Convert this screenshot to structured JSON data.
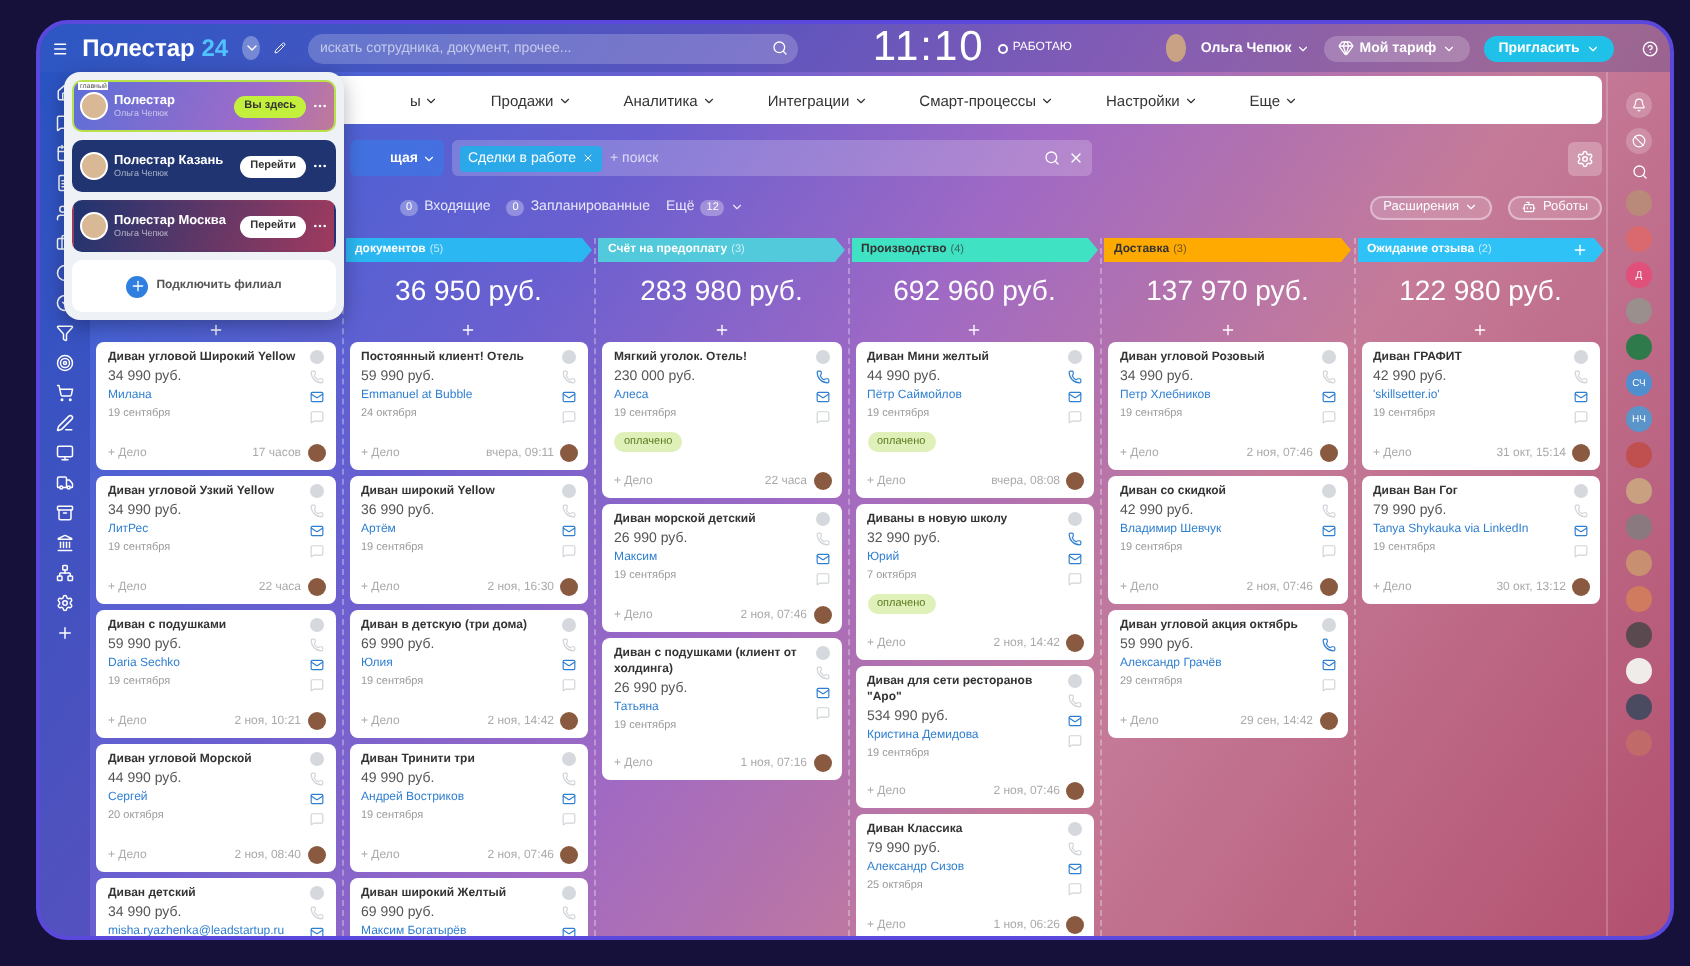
{
  "top_bar": {
    "logo": "Полестар",
    "logo_suffix": "24",
    "search": {
      "placeholder": "искать сотрудника, документ, прочее..."
    },
    "time": "11:10",
    "status": "РАБОТАЮ",
    "user": "Ольга Чепюк",
    "tariff_button": "Мой тариф",
    "invite_button": "Пригласить"
  },
  "nav": [
    "ы",
    "Продажи",
    "Аналитика",
    "Интеграции",
    "Смарт-процессы",
    "Настройки",
    "Еще"
  ],
  "filter": {
    "preset": "щая",
    "tag": "Сделки в работе",
    "placeholder": "+ поиск"
  },
  "counters": [
    {
      "count": "0",
      "label": "Входящие"
    },
    {
      "count": "0",
      "label": "Запланированные"
    }
  ],
  "more": {
    "label": "Ещё",
    "count": "12"
  },
  "toolbar_buttons": [
    "Расширения",
    "Роботы"
  ],
  "branches": {
    "items": [
      {
        "name": "Полестар",
        "owner": "Ольга Чепюк",
        "action": "Вы здесь",
        "selected": true,
        "main_label": "главный"
      },
      {
        "name": "Полестар Казань",
        "owner": "Ольга Чепюк",
        "action": "Перейти",
        "selected": false
      },
      {
        "name": "Полестар Москва",
        "owner": "Ольга Чепюк",
        "action": "Перейти",
        "selected": false
      }
    ],
    "add": "Подключить филиал"
  },
  "columns": [
    {
      "cards": [
        {
          "title": "Диван угловой Широкий Yellow",
          "price": "34 990 руб.",
          "contact": "Милана",
          "date": "19 сентября",
          "action": "+ Дело",
          "time": "17 часов",
          "phone_active": false
        },
        {
          "title": "Диван угловой Узкий Yellow",
          "price": "34 990 руб.",
          "contact": "ЛитРес",
          "date": "19 сентября",
          "action": "+ Дело",
          "time": "22 часа",
          "phone_active": false
        },
        {
          "title": "Диван с подушками",
          "price": "59 990 руб.",
          "contact": "Daria Sechko",
          "date": "19 сентября",
          "action": "+ Дело",
          "time": "2 ноя, 10:21",
          "phone_active": false
        },
        {
          "title": "Диван угловой Морской",
          "price": "44 990 руб.",
          "contact": "Сергей",
          "date": "20 октября",
          "action": "+ Дело",
          "time": "2 ноя, 08:40",
          "phone_active": false
        },
        {
          "title": "Диван детский",
          "price": "34 990 руб.",
          "contact": "misha.ryazhenka@leadstartup.ru",
          "phone_active": false
        }
      ]
    },
    {
      "title": "документов",
      "count": "(5)",
      "color": "#2bb8f2",
      "sum": "36 950 руб.",
      "cards": [
        {
          "title": "Постоянный клиент! Отель",
          "price": "59 990 руб.",
          "contact": "Emmanuel at Bubble",
          "date": "24 октября",
          "action": "+ Дело",
          "time": "вчера, 09:11",
          "phone_active": false
        },
        {
          "title": "Диван широкий Yellow",
          "price": "36 990 руб.",
          "contact": "Артём",
          "date": "19 сентября",
          "action": "+ Дело",
          "time": "2 ноя, 16:30",
          "phone_active": false
        },
        {
          "title": "Диван в детскую (три дома)",
          "price": "69 990 руб.",
          "contact": "Юлия",
          "date": "19 сентября",
          "action": "+ Дело",
          "time": "2 ноя, 14:42",
          "phone_active": false
        },
        {
          "title": "Диван Тринити три",
          "price": "49 990 руб.",
          "contact": "Андрей Востриков",
          "date": "19 сентября",
          "action": "+ Дело",
          "time": "2 ноя, 07:46",
          "phone_active": false
        },
        {
          "title": "Диван широкий Желтый",
          "price": "69 990 руб.",
          "contact": "Максим Богатырёв",
          "phone_active": false
        }
      ]
    },
    {
      "title": "Счёт на предоплату",
      "count": "(3)",
      "color": "#52cadb",
      "sum": "283 980 руб.",
      "cards": [
        {
          "title": "Мягкий уголок. Отель!",
          "price": "230 000 руб.",
          "contact": "Алеса",
          "date": "19 сентября",
          "tag": "оплачено",
          "action": "+ Дело",
          "time": "22 часа",
          "phone_active": true
        },
        {
          "title": "Диван морской детский",
          "price": "26 990 руб.",
          "contact": "Максим",
          "date": "19 сентября",
          "action": "+ Дело",
          "time": "2 ноя, 07:46",
          "phone_active": false
        },
        {
          "title": "Диван с подушками (клиент от холдинга)",
          "price": "26 990 руб.",
          "contact": "Татьяна",
          "date": "19 сентября",
          "action": "+ Дело",
          "time": "1 ноя, 07:16",
          "phone_active": false
        }
      ]
    },
    {
      "title": "Производство",
      "count": "(4)",
      "color": "#3fe2c2",
      "sum": "692 960 руб.",
      "cards": [
        {
          "title": "Диван Мини желтый",
          "price": "44 990 руб.",
          "contact": "Пётр Саймойлов",
          "date": "19 сентября",
          "tag": "оплачено",
          "action": "+ Дело",
          "time": "вчера, 08:08",
          "phone_active": true
        },
        {
          "title": "Диваны в новую школу",
          "price": "32 990 руб.",
          "contact": "Юрий",
          "date": "7 октября",
          "tag": "оплачено",
          "action": "+ Дело",
          "time": "2 ноя, 14:42",
          "phone_active": true
        },
        {
          "title": "Диван для сети ресторанов \"Аро\"",
          "price": "534 990 руб.",
          "contact": "Кристина Демидова",
          "date": "19 сентября",
          "action": "+ Дело",
          "time": "2 ноя, 07:46",
          "phone_active": false
        },
        {
          "title": "Диван Классика",
          "price": "79 990 руб.",
          "contact": "Александр Сизов",
          "date": "25 октября",
          "action": "+ Дело",
          "time": "1 ноя, 06:26",
          "phone_active": false
        }
      ]
    },
    {
      "title": "Доставка",
      "count": "(3)",
      "color": "#ffaa00",
      "sum": "137 970 руб.",
      "cards": [
        {
          "title": "Диван угловой Розовый",
          "price": "34 990 руб.",
          "contact": "Петр Хлебников",
          "date": "19 сентября",
          "action": "+ Дело",
          "time": "2 ноя, 07:46",
          "phone_active": false
        },
        {
          "title": "Диван со скидкой",
          "price": "42 990 руб.",
          "contact": "Владимир Шевчук",
          "date": "19 сентября",
          "action": "+ Дело",
          "time": "2 ноя, 07:46",
          "phone_active": false
        },
        {
          "title": "Диван угловой акция октябрь",
          "price": "59 990 руб.",
          "contact": "Александр Грачёв",
          "date": "29 сентября",
          "action": "+ Дело",
          "time": "29 сен, 14:42",
          "phone_active": true
        }
      ]
    },
    {
      "title": "Ожидание отзыва",
      "count": "(2)",
      "color": "#2fc2f6",
      "sum": "122 980 руб.",
      "cards": [
        {
          "title": "Диван ГРАФИТ",
          "price": "42 990 руб.",
          "contact": "'skillsetter.io'",
          "date": "19 сентября",
          "action": "+ Дело",
          "time": "31 окт, 15:14",
          "phone_active": false
        },
        {
          "title": "Диван Ван Гог",
          "price": "79 990 руб.",
          "contact": "Tanya Shykauka via LinkedIn",
          "date": "19 сентября",
          "action": "+ Дело",
          "time": "30 окт, 13:12",
          "phone_active": false
        }
      ]
    }
  ],
  "people": [
    {
      "kind": "photo",
      "color": "#b98a7a"
    },
    {
      "kind": "photo",
      "color": "#d9696e"
    },
    {
      "kind": "initials",
      "initials": "Д",
      "color": "#e0507a"
    },
    {
      "kind": "photo",
      "color": "#9a8f8c"
    },
    {
      "kind": "photo",
      "color": "#2f7a4a"
    },
    {
      "kind": "initials",
      "initials": "СЧ",
      "color": "#4f8fd0"
    },
    {
      "kind": "initials",
      "initials": "НЧ",
      "color": "#5a94c8"
    },
    {
      "kind": "photo",
      "color": "#c05050"
    },
    {
      "kind": "photo",
      "color": "#c9a080"
    },
    {
      "kind": "photo",
      "color": "#8a7a80"
    },
    {
      "kind": "photo",
      "color": "#c89070"
    },
    {
      "kind": "photo",
      "color": "#d07a60"
    },
    {
      "kind": "photo",
      "color": "#5a4a50"
    },
    {
      "kind": "photo",
      "color": "#f0ecea"
    },
    {
      "kind": "photo",
      "color": "#4a4a60"
    },
    {
      "kind": "photo",
      "color": "#c06a6a"
    }
  ]
}
